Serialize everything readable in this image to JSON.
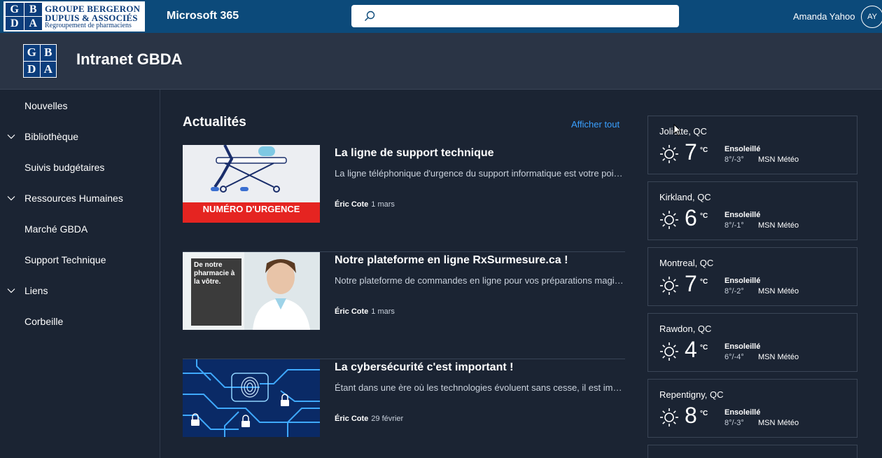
{
  "suite_bar": {
    "logo_monogram": [
      "G",
      "B",
      "D",
      "A"
    ],
    "logo_line1": "GROUPE BERGERON",
    "logo_line2": "DUPUIS & ASSOCIÉS",
    "logo_line3": "Regroupement de pharmaciens",
    "app_name": "Microsoft 365",
    "user_name": "Amanda Yahoo",
    "user_initials": "AY"
  },
  "site": {
    "logo_monogram": [
      "G",
      "B",
      "D",
      "A"
    ],
    "title": "Intranet GBDA"
  },
  "nav": {
    "items": [
      {
        "label": "Nouvelles",
        "expandable": false
      },
      {
        "label": "Bibliothèque",
        "expandable": true
      },
      {
        "label": "Suivis budgétaires",
        "expandable": false
      },
      {
        "label": "Ressources Humaines",
        "expandable": true
      },
      {
        "label": "Marché GBDA",
        "expandable": false
      },
      {
        "label": "Support Technique",
        "expandable": false
      },
      {
        "label": "Liens",
        "expandable": true
      },
      {
        "label": "Corbeille",
        "expandable": false
      }
    ]
  },
  "news": {
    "title": "Actualités",
    "see_all": "Afficher tout",
    "items": [
      {
        "headline": "La ligne de support technique",
        "description": "La ligne téléphonique d'urgence du support informatique est votre point de contact",
        "author": "Éric Cote",
        "date": "1 mars",
        "thumb_text": "NUMÉRO D'URGENCE"
      },
      {
        "headline": "Notre plateforme en ligne RxSurmesure.ca !",
        "description": "Notre plateforme de commandes en ligne pour vos préparations magistrales",
        "author": "Éric Cote",
        "date": "1 mars",
        "thumb_text": "De notre pharmacie à la vôtre."
      },
      {
        "headline": "La cybersécurité c'est important !",
        "description": "Étant dans une ère où les technologies évoluent sans cesse, il est important",
        "author": "Éric Cote",
        "date": "29 février",
        "thumb_text": ""
      }
    ]
  },
  "weather": {
    "cards": [
      {
        "city": "Joliette, QC",
        "temp": "7",
        "unit": "°C",
        "condition": "Ensoleillé",
        "range": "8°/-3°",
        "source": "MSN Météo"
      },
      {
        "city": "Kirkland, QC",
        "temp": "6",
        "unit": "°C",
        "condition": "Ensoleillé",
        "range": "8°/-1°",
        "source": "MSN Météo"
      },
      {
        "city": "Montreal, QC",
        "temp": "7",
        "unit": "°C",
        "condition": "Ensoleillé",
        "range": "8°/-2°",
        "source": "MSN Météo"
      },
      {
        "city": "Rawdon, QC",
        "temp": "4",
        "unit": "°C",
        "condition": "Ensoleillé",
        "range": "6°/-4°",
        "source": "MSN Météo"
      },
      {
        "city": "Repentigny, QC",
        "temp": "8",
        "unit": "°C",
        "condition": "Ensoleillé",
        "range": "8°/-3°",
        "source": "MSN Météo"
      }
    ]
  },
  "colors": {
    "suite_bar": "#0c4a7a",
    "background": "#1b2433",
    "header": "#2a3445",
    "accent_link": "#3aa0ff",
    "logo_blue": "#0c3d7c",
    "urgent_red": "#e52421"
  }
}
